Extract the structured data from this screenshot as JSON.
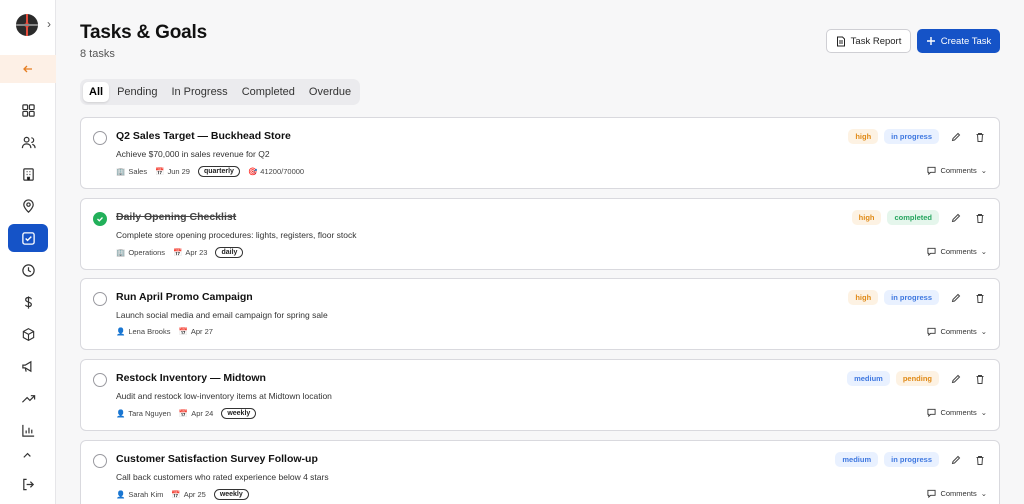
{
  "header": {
    "title": "Tasks & Goals",
    "count": "8 tasks"
  },
  "actions": {
    "report_label": "Task Report",
    "create_label": "Create Task"
  },
  "tabs": [
    {
      "label": "All",
      "active": true
    },
    {
      "label": "Pending"
    },
    {
      "label": "In Progress"
    },
    {
      "label": "Completed"
    },
    {
      "label": "Overdue"
    }
  ],
  "sidebar": {
    "items": [
      {
        "name": "dashboard-icon"
      },
      {
        "name": "users-icon"
      },
      {
        "name": "building-icon"
      },
      {
        "name": "location-icon"
      },
      {
        "name": "tasks-icon",
        "active": true
      },
      {
        "name": "clock-icon"
      },
      {
        "name": "dollar-icon"
      },
      {
        "name": "package-icon"
      },
      {
        "name": "megaphone-icon"
      },
      {
        "name": "trending-icon"
      },
      {
        "name": "bar-chart-icon"
      },
      {
        "name": "partial-icon"
      },
      {
        "name": "logout-icon"
      }
    ]
  },
  "tasks": [
    {
      "title": "Q2 Sales Target — Buckhead Store",
      "desc": "Achieve $70,000 in sales revenue for Q2",
      "meta1": "Sales",
      "date": "Jun 29",
      "recurrence": "quarterly",
      "progress": "41200/70000",
      "priority": "high",
      "status": "in progress",
      "comments": "Comments",
      "done": false
    },
    {
      "title": "Daily Opening Checklist",
      "desc": "Complete store opening procedures: lights, registers, floor stock",
      "meta1": "Operations",
      "date": "Apr 23",
      "recurrence": "daily",
      "priority": "high",
      "status": "completed",
      "comments": "Comments",
      "done": true
    },
    {
      "title": "Run April Promo Campaign",
      "desc": "Launch social media and email campaign for spring sale",
      "meta1": "Lena Brooks",
      "date": "Apr 27",
      "priority": "high",
      "status": "in progress",
      "comments": "Comments",
      "done": false
    },
    {
      "title": "Restock Inventory — Midtown",
      "desc": "Audit and restock low-inventory items at Midtown location",
      "meta1": "Tara Nguyen",
      "date": "Apr 24",
      "recurrence": "weekly",
      "priority": "medium",
      "status": "pending",
      "comments": "Comments",
      "done": false
    },
    {
      "title": "Customer Satisfaction Survey Follow-up",
      "desc": "Call back customers who rated experience below 4 stars",
      "meta1": "Sarah Kim",
      "date": "Apr 25",
      "recurrence": "weekly",
      "priority": "medium",
      "status": "in progress",
      "comments": "Comments",
      "done": false
    }
  ]
}
